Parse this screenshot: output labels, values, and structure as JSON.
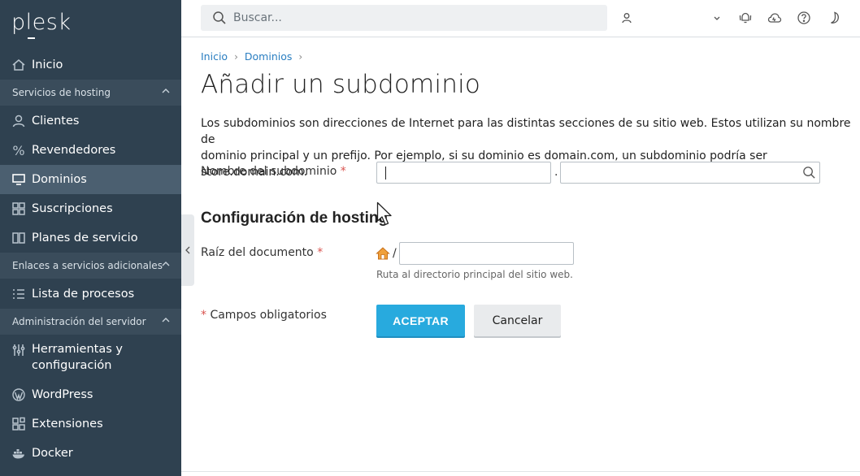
{
  "sidebar": {
    "logo": "plesk",
    "items": {
      "home": "Inicio",
      "clients": "Clientes",
      "resellers": "Revendedores",
      "domains": "Dominios",
      "subscriptions": "Suscripciones",
      "plans": "Planes de servicio",
      "processes": "Lista de procesos",
      "tools_line1": "Herramientas y",
      "tools_line2": "configuración",
      "wordpress": "WordPress",
      "extensions": "Extensiones",
      "docker": "Docker"
    },
    "sections": {
      "hosting": "Servicios de hosting",
      "links": "Enlaces a servicios adicionales",
      "admin": "Administración del servidor"
    },
    "active_color": "#4b5f70",
    "bg_color": "#2f4150"
  },
  "topbar": {
    "search_placeholder": "Buscar..."
  },
  "breadcrumb": {
    "home": "Inicio",
    "domains": "Dominios"
  },
  "main": {
    "title": "Añadir un subdominio",
    "intro_line1": "Los subdominios son direcciones de Internet para las distintas secciones de su sitio web. Estos utilizan su nombre de",
    "intro_line2": "dominio principal y un prefijo. Por ejemplo, si su dominio es domain.com, un subdominio podría ser store.domain.com.",
    "subdomain_label": "Nombre del subdominio",
    "subdomain_value": "",
    "domain_value": "",
    "dot": ".",
    "hosting_section": "Configuración de hosting",
    "docroot_label": "Raíz del documento",
    "docroot_slash": "/",
    "docroot_value": "",
    "docroot_hint": "Ruta al directorio principal del sitio web.",
    "required_star": "*",
    "required_note": "Campos obligatorios",
    "ok_button": "ACEPTAR",
    "cancel_button": "Cancelar",
    "accent_color": "#28aade"
  }
}
